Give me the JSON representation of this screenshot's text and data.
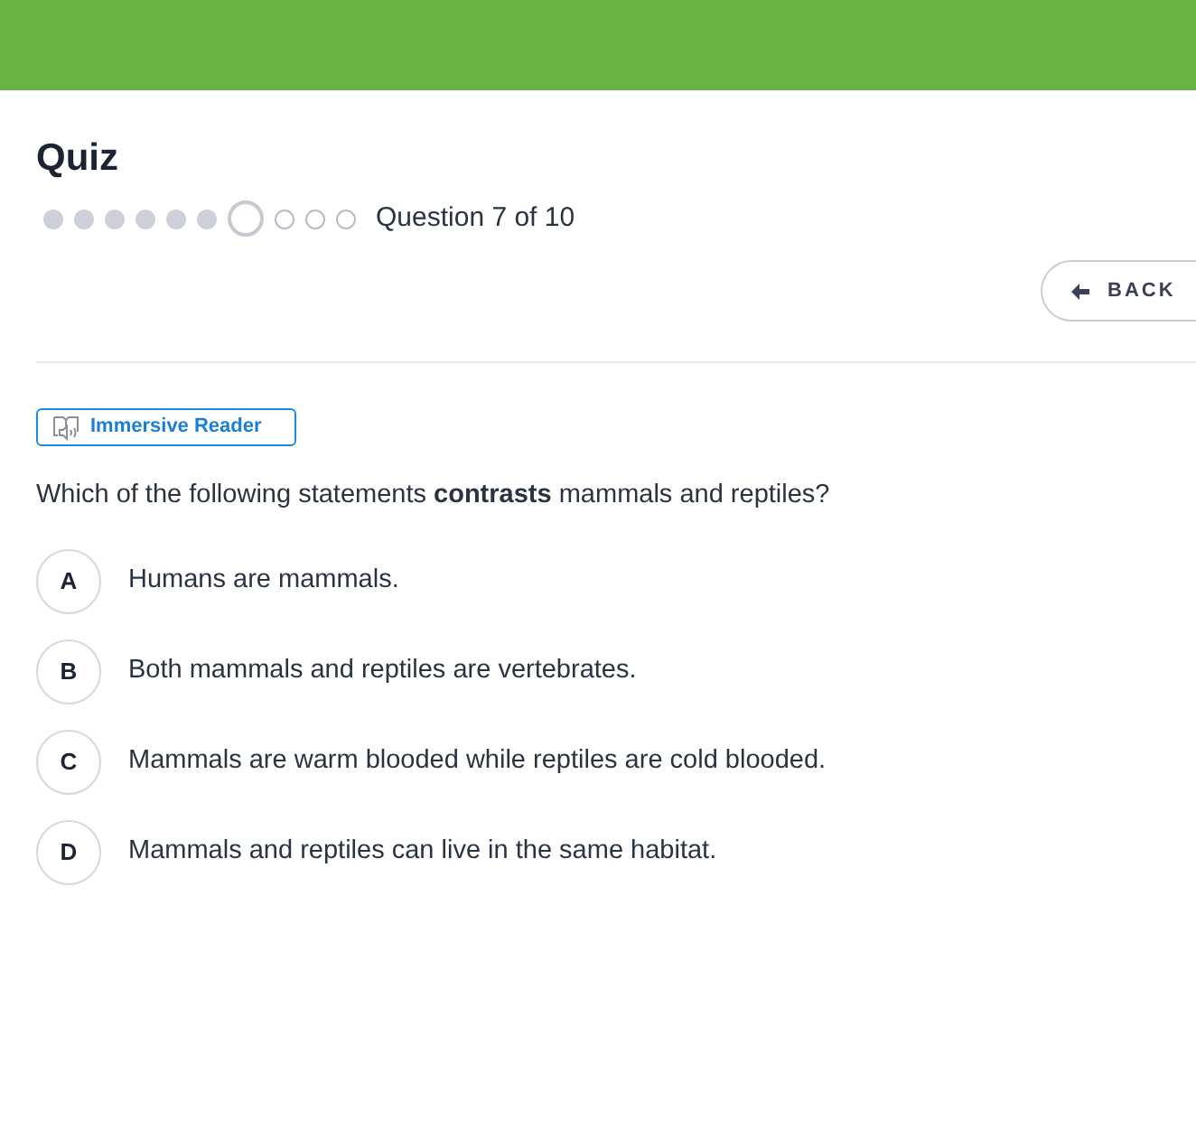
{
  "title": "Quiz",
  "progress": {
    "steps": [
      {
        "kind": "done"
      },
      {
        "kind": "done"
      },
      {
        "kind": "done"
      },
      {
        "kind": "done"
      },
      {
        "kind": "done"
      },
      {
        "kind": "done"
      },
      {
        "kind": "current"
      },
      {
        "kind": "todo"
      },
      {
        "kind": "todo"
      },
      {
        "kind": "todo"
      }
    ],
    "label": "Question 7 of 10"
  },
  "back_button": {
    "label": "BACK"
  },
  "immersive_reader": {
    "label": "Immersive Reader"
  },
  "question": "Which of the following statements **contrasts** mammals and reptiles?",
  "options": [
    {
      "letter": "A",
      "text": "Humans are mammals."
    },
    {
      "letter": "B",
      "text": "Both mammals and reptiles are vertebrates."
    },
    {
      "letter": "C",
      "text": "Mammals are warm blooded while reptiles are cold blooded."
    },
    {
      "letter": "D",
      "text": "Mammals and reptiles can live in the same habitat."
    }
  ]
}
